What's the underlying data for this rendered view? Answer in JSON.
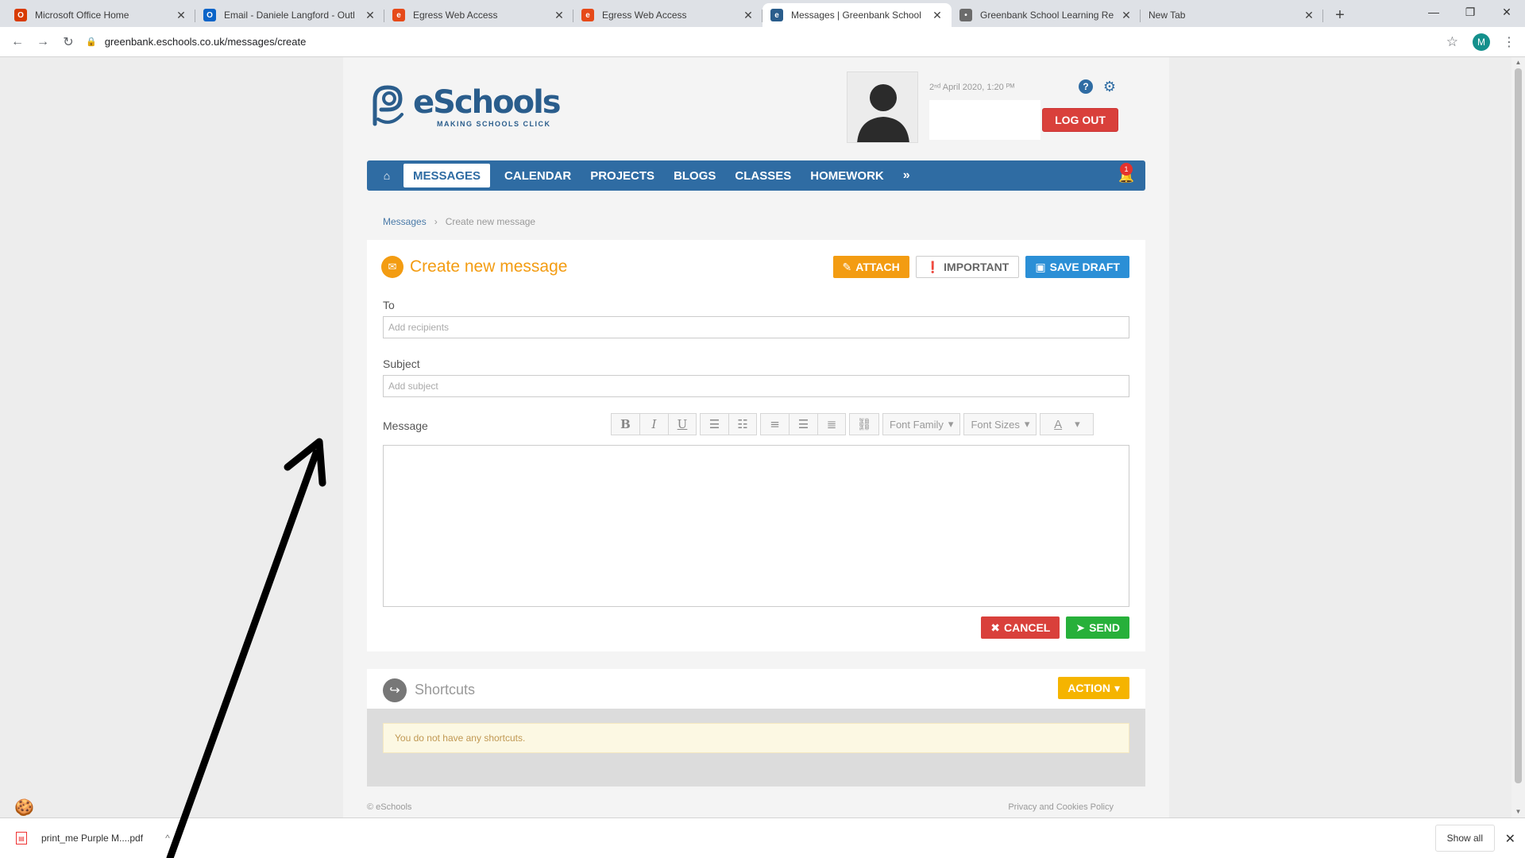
{
  "browser": {
    "tabs": [
      {
        "title": "Microsoft Office Home",
        "color": "#d83b01",
        "glyph": "O"
      },
      {
        "title": "Email - Daniele Langford - Outl",
        "color": "#0a64c8",
        "glyph": "O"
      },
      {
        "title": "Egress Web Access",
        "color": "#e64a19",
        "glyph": "e"
      },
      {
        "title": "Egress Web Access",
        "color": "#e64a19",
        "glyph": "e"
      },
      {
        "title": "Messages | Greenbank School",
        "color": "#2a5d8c",
        "glyph": "e",
        "active": true
      },
      {
        "title": "Greenbank School Learning Re",
        "color": "#6b6b6b",
        "glyph": "•"
      },
      {
        "title": "New Tab",
        "color": "",
        "glyph": ""
      }
    ],
    "url": "greenbank.eschools.co.uk/messages/create",
    "profile_initial": "M"
  },
  "header": {
    "brand": "eSchools",
    "tagline": "MAKING SCHOOLS CLICK",
    "date_text": "2ⁿᵈ April 2020, 1:20 ᴾᴹ",
    "logout_label": "LOG OUT"
  },
  "nav": {
    "items": [
      "MESSAGES",
      "CALENDAR",
      "PROJECTS",
      "BLOGS",
      "CLASSES",
      "HOMEWORK"
    ],
    "more": "»",
    "badge": "1"
  },
  "breadcrumb": {
    "root": "Messages",
    "sep": "›",
    "current": "Create new message"
  },
  "compose": {
    "title": "Create new message",
    "attach_label": "ATTACH",
    "important_label": "IMPORTANT",
    "save_draft_label": "SAVE DRAFT",
    "to_label": "To",
    "to_placeholder": "Add recipients",
    "subject_label": "Subject",
    "subject_placeholder": "Add subject",
    "message_label": "Message",
    "editor": {
      "bold": "B",
      "italic": "I",
      "underline": "U",
      "font_family": "Font Family",
      "font_sizes": "Font Sizes",
      "text_color": "A"
    },
    "cancel_label": "CANCEL",
    "send_label": "SEND"
  },
  "shortcuts": {
    "title": "Shortcuts",
    "action_label": "ACTION",
    "empty_message": "You do not have any shortcuts."
  },
  "footer": {
    "copyright": "© eSchools",
    "privacy": "Privacy and Cookies Policy"
  },
  "downloads": {
    "file_name": "print_me Purple M....pdf",
    "show_all": "Show all"
  },
  "colors": {
    "nav_blue": "#2f6ca3",
    "orange": "#f39c12",
    "red": "#d9403b",
    "green": "#27b03a",
    "blue": "#2b8fd6",
    "yellow": "#f5b400"
  }
}
